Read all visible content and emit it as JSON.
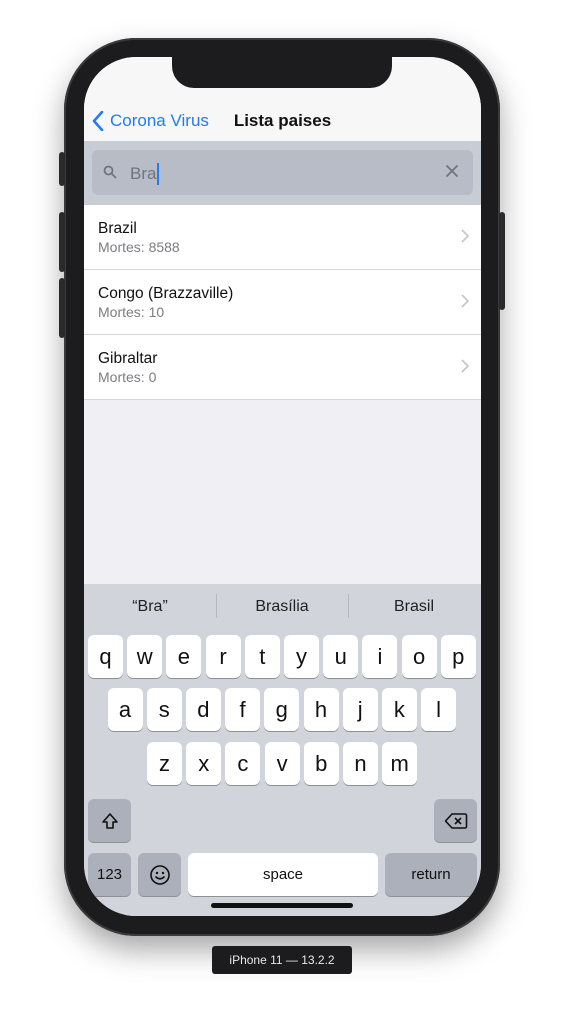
{
  "navbar": {
    "back_label": "Corona Virus",
    "title": "Lista paises"
  },
  "search": {
    "value": "Bra"
  },
  "rows": [
    {
      "name": "Brazil",
      "detail": "Mortes: 8588"
    },
    {
      "name": "Congo (Brazzaville)",
      "detail": "Mortes: 10"
    },
    {
      "name": "Gibraltar",
      "detail": "Mortes: 0"
    }
  ],
  "keyboard": {
    "suggestions": [
      "“Bra”",
      "Brasília",
      "Brasil"
    ],
    "row1": [
      "q",
      "w",
      "e",
      "r",
      "t",
      "y",
      "u",
      "i",
      "o",
      "p"
    ],
    "row2": [
      "a",
      "s",
      "d",
      "f",
      "g",
      "h",
      "j",
      "k",
      "l"
    ],
    "row3": [
      "z",
      "x",
      "c",
      "v",
      "b",
      "n",
      "m"
    ],
    "numbers_label": "123",
    "space_label": "space",
    "return_label": "return"
  },
  "device_label": "iPhone 11 — 13.2.2",
  "colors": {
    "accent": "#1f7cf6",
    "background": "#efeff4"
  }
}
